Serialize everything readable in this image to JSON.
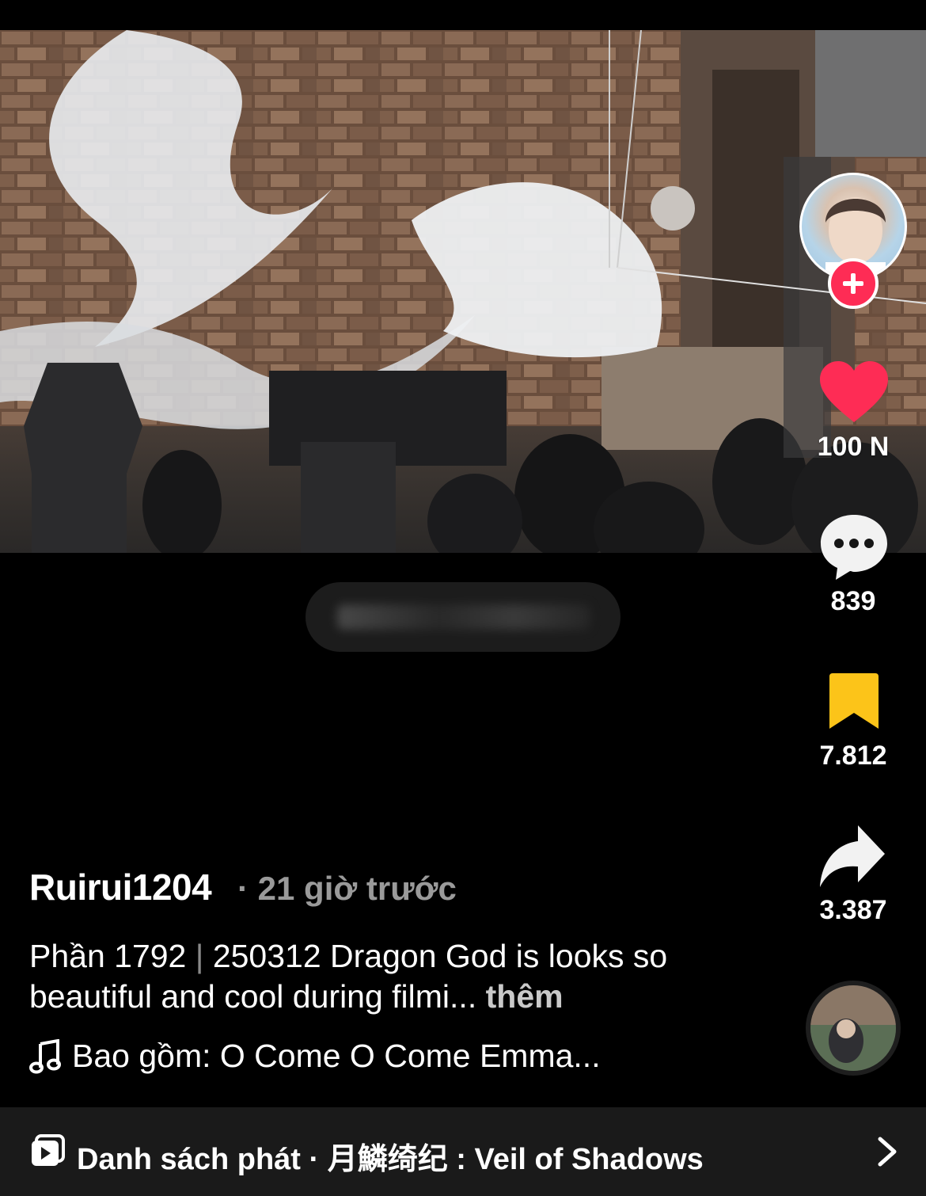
{
  "post": {
    "author": "Ruirui1204",
    "time": "· 21 giờ trước",
    "description_prefix": "Phần 1792",
    "description_separator": "|",
    "description_text": "250312 Dragon God is looks so beautiful and cool during filmi...",
    "more_label": "thêm",
    "music": "Bao gồm: O Come O Come Emma..."
  },
  "actions": {
    "likes": "100 N",
    "comments": "839",
    "saves": "7.812",
    "shares": "3.387"
  },
  "playlist": {
    "label": "Danh sách phát · 月鱗绮纪 : Veil of Shadows"
  },
  "colors": {
    "like": "#fe2c55",
    "save": "#fcc419",
    "follow": "#fe2c55"
  },
  "icons": [
    "plus-icon",
    "heart-icon",
    "comment-icon",
    "bookmark-icon",
    "share-icon",
    "music-note-icon",
    "playlist-icon",
    "chevron-right-icon"
  ]
}
